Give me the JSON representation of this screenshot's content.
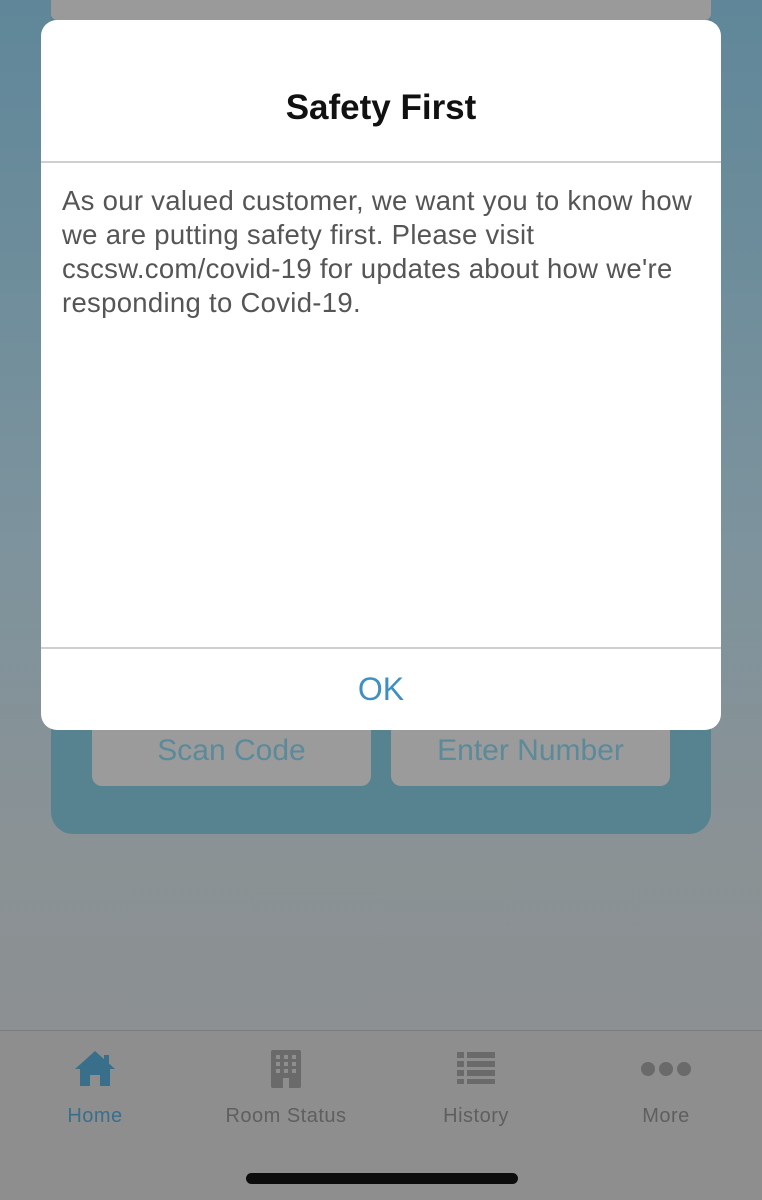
{
  "alert": {
    "title": "Safety First",
    "message": "As our valued customer, we want you to know how we are putting safety first. Please visit cscsw.com/covid-19 for updates about how we're responding to Covid-19.",
    "ok_label": "OK"
  },
  "background_card": {
    "scan_code_label": "Scan Code",
    "enter_number_label": "Enter Number"
  },
  "tabbar": {
    "active": "Home",
    "items": [
      {
        "label": "Home",
        "icon": "home-icon"
      },
      {
        "label": "Room Status",
        "icon": "building-icon"
      },
      {
        "label": "History",
        "icon": "list-icon"
      },
      {
        "label": "More",
        "icon": "more-dots-icon"
      }
    ]
  },
  "colors": {
    "accent": "#3d90bf",
    "active_tab": "#3a6f8c",
    "card_background": "#56838f"
  }
}
